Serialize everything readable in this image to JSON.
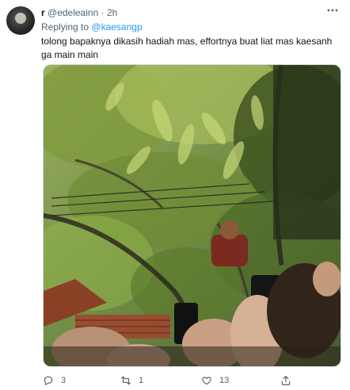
{
  "tweet": {
    "display_name": "r",
    "handle": "@edeleainn",
    "separator": "·",
    "time": "2h",
    "more_icon": "more-horizontal-icon",
    "replying_prefix": "Replying to",
    "replying_to": "@kaesangp",
    "text": "tolong bapaknya dikasih hadiah mas, effortnya buat liat mas kaesanh ga main main"
  },
  "actions": {
    "reply_count": "3",
    "retweet_count": "1",
    "like_count": "13",
    "reply_icon": "comment-icon",
    "retweet_icon": "retweet-icon",
    "like_icon": "heart-icon",
    "share_icon": "share-icon"
  },
  "colors": {
    "text_primary": "#0f1419",
    "text_secondary": "#536471",
    "link": "#1d9bf0",
    "border": "#cfd9de"
  }
}
